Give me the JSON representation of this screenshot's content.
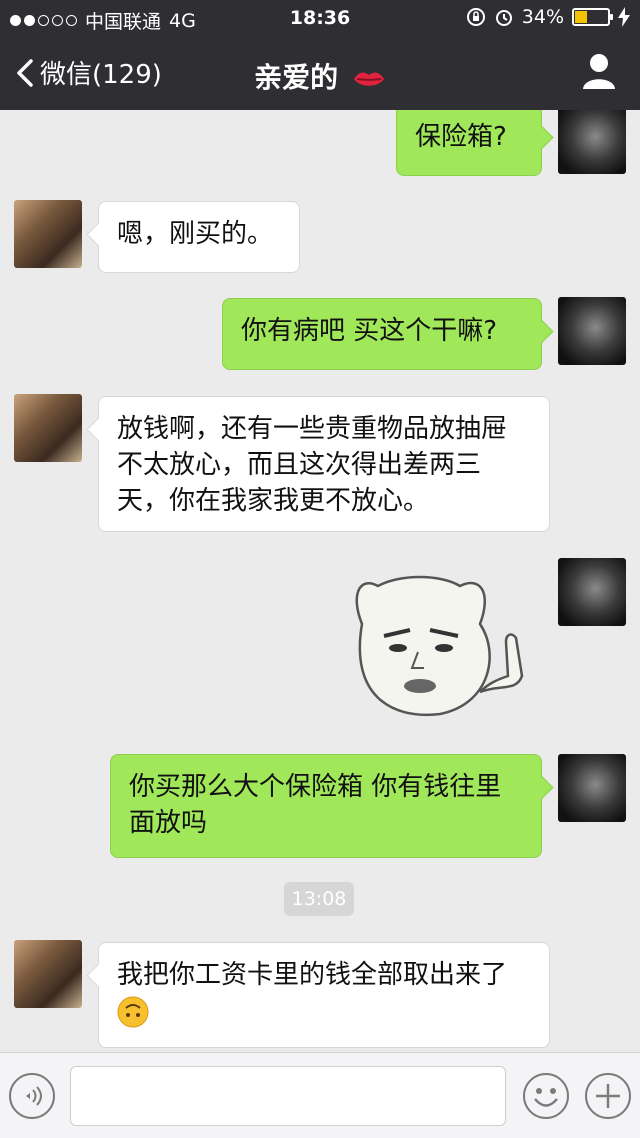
{
  "status_bar": {
    "carrier": "中国联通",
    "network": "4G",
    "time": "18:36",
    "battery": "34%",
    "signal_full": 2,
    "signal_total": 5
  },
  "nav": {
    "back_label": "微信(129)",
    "title": "亲爱的"
  },
  "messages": [
    {
      "from": "me",
      "text": "保险箱?"
    },
    {
      "from": "her",
      "text": "嗯，刚买的。"
    },
    {
      "from": "me",
      "text": "你有病吧 买这个干嘛?"
    },
    {
      "from": "her",
      "text": "放钱啊，还有一些贵重物品放抽屉不太放心，而且这次得出差两三天，你在我家我更不放心。"
    },
    {
      "from": "me",
      "type": "sticker"
    },
    {
      "from": "me",
      "text": "你买那么大个保险箱 你有钱往里面放吗"
    },
    {
      "type": "timestamp",
      "text": "13:08"
    },
    {
      "from": "her",
      "text": "我把你工资卡里的钱全部取出来了"
    }
  ],
  "colors": {
    "nav_bg": "#2e2e33",
    "chat_bg": "#ebebeb",
    "outgoing_bubble": "#a0e75a",
    "incoming_bubble": "#ffffff",
    "battery_fill": "#f4c400"
  },
  "icons": {
    "back": "chevron-left-icon",
    "profile": "person-icon",
    "voice": "voice-icon",
    "emoji": "emoji-icon",
    "add": "plus-icon"
  }
}
